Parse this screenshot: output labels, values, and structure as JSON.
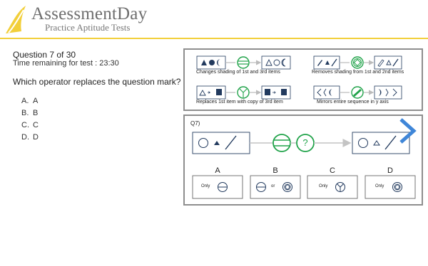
{
  "header": {
    "brand": "AssessmentDay",
    "tagline": "Practice Aptitude Tests",
    "accent_color": "#f2cf3a"
  },
  "question": {
    "number_text": "Question 7 of 30",
    "timer_text": "Time remaining for test : 23:30",
    "prompt": "Which operator replaces the question mark?"
  },
  "options": [
    {
      "key": "A.",
      "label": "A"
    },
    {
      "key": "B.",
      "label": "B"
    },
    {
      "key": "C.",
      "label": "C"
    },
    {
      "key": "D.",
      "label": "D"
    }
  ],
  "examples": [
    {
      "caption": "Changes shading of 1st and 3rd items",
      "operator_icon": "horizontal-bars-circle"
    },
    {
      "caption": "Removes shading from 1st and 2nd items",
      "operator_icon": "diamond-in-circle"
    },
    {
      "caption": "Replaces 1st item with copy of 3rd item",
      "operator_icon": "y-in-circle"
    },
    {
      "caption": "Mirrors entire sequence in y axis",
      "operator_icon": "filled-bar-circle"
    }
  ],
  "puzzle": {
    "tag": "Q7)",
    "unknown_symbol": "?",
    "operator_color": "#21a34a",
    "answers": [
      {
        "letter": "A",
        "text": "Only",
        "icon": "horizontal-bar-circle"
      },
      {
        "letter": "B",
        "text": "or",
        "icon": "bar-or-diamond-circle"
      },
      {
        "letter": "C",
        "text": "Only",
        "icon": "y-in-circle"
      },
      {
        "letter": "D",
        "text": "Only",
        "icon": "diamond-in-circle"
      }
    ]
  },
  "nav": {
    "next_icon": "chevron-right-icon",
    "next_color": "#3f86d8"
  }
}
